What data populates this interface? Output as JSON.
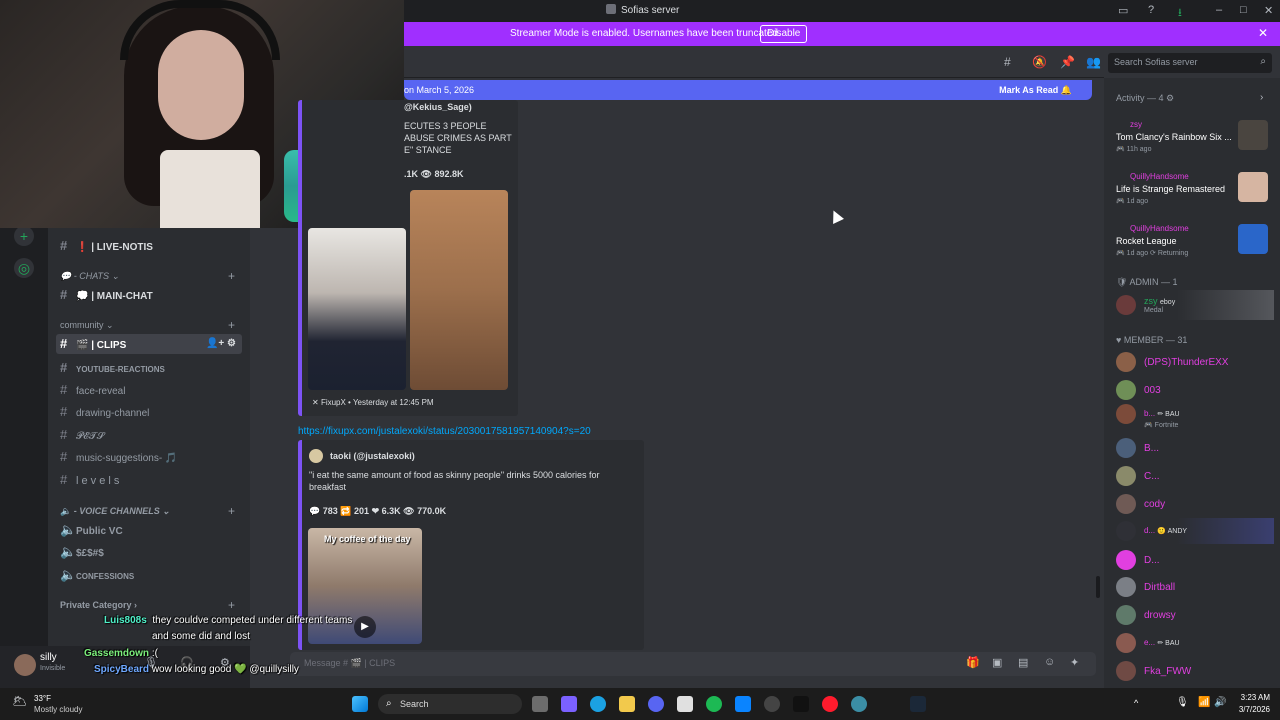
{
  "window": {
    "title": "Sofias server"
  },
  "banner": {
    "message": "Streamer Mode is enabled. Usernames have been truncated.",
    "button": "Disable"
  },
  "sidebar": {
    "categories": {
      "chats": "- CHATS",
      "community": "community",
      "voice": "- VOICE CHANNELS",
      "private": "Private Category"
    },
    "channels": [
      {
        "name": "| LIVE-NOTIS",
        "prefix": "❗"
      },
      {
        "name": "| MAIN-CHAT",
        "prefix": "💭"
      },
      {
        "name": "| CLIPS",
        "prefix": "🎬"
      },
      {
        "name": "YOUTUBE-REACTIONS"
      },
      {
        "name": "face-reveal"
      },
      {
        "name": "drawing-channel"
      },
      {
        "name": "𝓟𝓔𝓣𝓢"
      },
      {
        "name": "music-suggestions- 🎵"
      },
      {
        "name": "l e v e l s"
      }
    ],
    "voice": [
      {
        "name": "Public VC"
      },
      {
        "name": "$£$#$"
      },
      {
        "name": "CONFESSIONS"
      }
    ]
  },
  "header": {
    "search_placeholder": "Search Sofias server"
  },
  "newbar": {
    "left": "on March 5, 2026",
    "right": "Mark As Read"
  },
  "messages": {
    "embed1": {
      "handle": "@Kekius_Sage)",
      "lines": [
        "ECUTES 3 PEOPLE",
        "ABUSE CRIMES AS PART",
        "E\" STANCE"
      ],
      "stats": ".1K",
      "views": "892.8K",
      "footer": "FixupX • Yesterday at 12:45 PM"
    },
    "link": "https://fixupx.com/justalexoki/status/2030017581957140904?s=20",
    "embed2": {
      "author": "taoki (@justalexoki)",
      "text_line1": "\"i eat the same amount of food as skinny people\" drinks 5000 calories for",
      "text_line2": "breakfast",
      "replies": "783",
      "retweets": "201",
      "likes": "6.3K",
      "views": "770.0K",
      "image_caption": "My coffee of the day"
    }
  },
  "composer": {
    "placeholder": "Message # 🎬 | CLIPS"
  },
  "members": {
    "activity_header": "Activity — 4",
    "activities": [
      {
        "user": "zsy",
        "game": "Tom Clancy's Rainbow Six ...",
        "time": "11h ago"
      },
      {
        "user": "QuillyHandsome",
        "game": "Life is Strange Remastered",
        "time": "1d ago"
      },
      {
        "user": "QuillyHandsome",
        "game": "Rocket League",
        "time": "1d ago",
        "extra": "Returning"
      }
    ],
    "admin_header": "ADMIN — 1",
    "admin": {
      "name": "zsy",
      "tag": "eboy",
      "sub": "Medal"
    },
    "member_header": "MEMBER — 31",
    "list": [
      {
        "name": "(DPS)ThunderEXX"
      },
      {
        "name": "003"
      },
      {
        "name": "b...",
        "tag": "BAU",
        "sub": "Fortnite"
      },
      {
        "name": "B..."
      },
      {
        "name": "C..."
      },
      {
        "name": "cody"
      },
      {
        "name": "d...",
        "tag": "ANDY"
      },
      {
        "name": "D..."
      },
      {
        "name": "Dirtball"
      },
      {
        "name": "drowsy"
      },
      {
        "name": "e...",
        "tag": "BAU"
      },
      {
        "name": "Fka_FWW"
      }
    ]
  },
  "user_panel": {
    "name": "silly",
    "status": "Invisible"
  },
  "overlay_chat": [
    {
      "user": "Luis808s",
      "text": "they couldve competed under different teams",
      "text2": "and some did and lost"
    },
    {
      "user": "Gassemdown",
      "text": ":("
    },
    {
      "user": "SpicyBeard",
      "text": "wow looking good 💚 @quillysilly"
    }
  ],
  "taskbar": {
    "weather_temp": "33°F",
    "weather_desc": "Mostly cloudy",
    "search": "Search",
    "time": "3:23 AM",
    "date": "3/7/2026"
  }
}
